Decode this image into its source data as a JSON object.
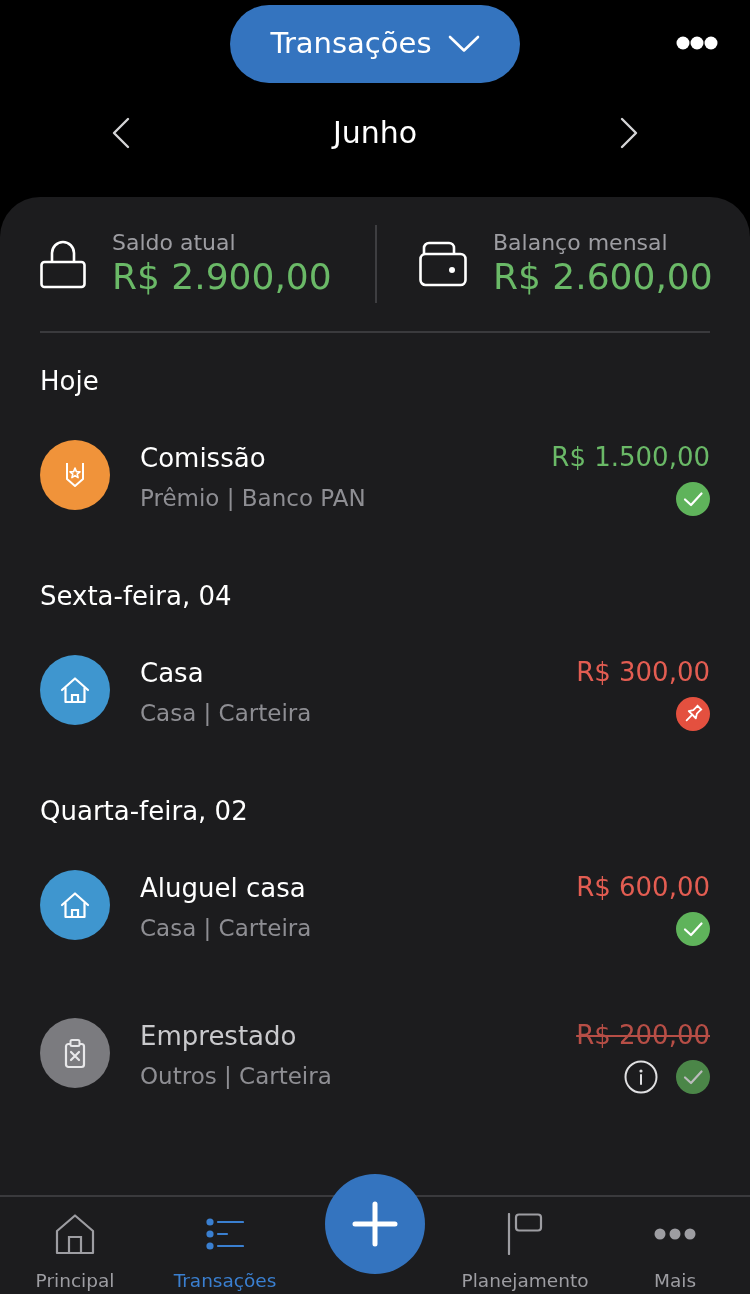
{
  "header": {
    "title_menu": {
      "label": "Transações"
    }
  },
  "month_nav": {
    "label": "Junho"
  },
  "summary": [
    {
      "kind": "lock",
      "label": "Saldo atual",
      "value": "R$ 2.900,00"
    },
    {
      "kind": "wallet",
      "label": "Balanço mensal",
      "value": "R$ 2.600,00"
    }
  ],
  "sections": [
    {
      "title": "Hoje",
      "transactions": [
        {
          "kind": "award",
          "color": "#f0933a",
          "title": "Comissão",
          "subtitle": "Prêmio | Banco PAN",
          "amount": "R$ 1.500,00",
          "expense": false,
          "ignored": false,
          "statuses": [
            {
              "kind": "paid"
            }
          ]
        }
      ]
    },
    {
      "title": "Sexta-feira, 04",
      "transactions": [
        {
          "kind": "home",
          "color": "#3f96cf",
          "title": "Casa",
          "subtitle": "Casa | Carteira",
          "amount": "R$ 300,00",
          "expense": true,
          "ignored": false,
          "statuses": [
            {
              "kind": "pinned"
            }
          ]
        }
      ]
    },
    {
      "title": "Quarta-feira, 02",
      "transactions": [
        {
          "kind": "home",
          "color": "#3f96cf",
          "title": "Aluguel casa",
          "subtitle": "Casa | Carteira",
          "amount": "R$ 600,00",
          "expense": true,
          "ignored": false,
          "statuses": [
            {
              "kind": "paid"
            }
          ]
        },
        {
          "kind": "other",
          "color": "#7b7b7f",
          "title": "Emprestado",
          "subtitle": "Outros | Carteira",
          "amount": "R$ 200,00",
          "expense": true,
          "ignored": true,
          "statuses": [
            {
              "kind": "info"
            },
            {
              "kind": "paid"
            }
          ]
        }
      ]
    }
  ],
  "tab_bar": {
    "items": [
      {
        "kind": "home",
        "label": "Principal",
        "selected": false
      },
      {
        "kind": "list",
        "label": "Transações",
        "selected": true
      },
      {
        "kind": "plan",
        "label": "Planejamento",
        "selected": false
      },
      {
        "kind": "more",
        "label": "Mais",
        "selected": false
      }
    ]
  }
}
